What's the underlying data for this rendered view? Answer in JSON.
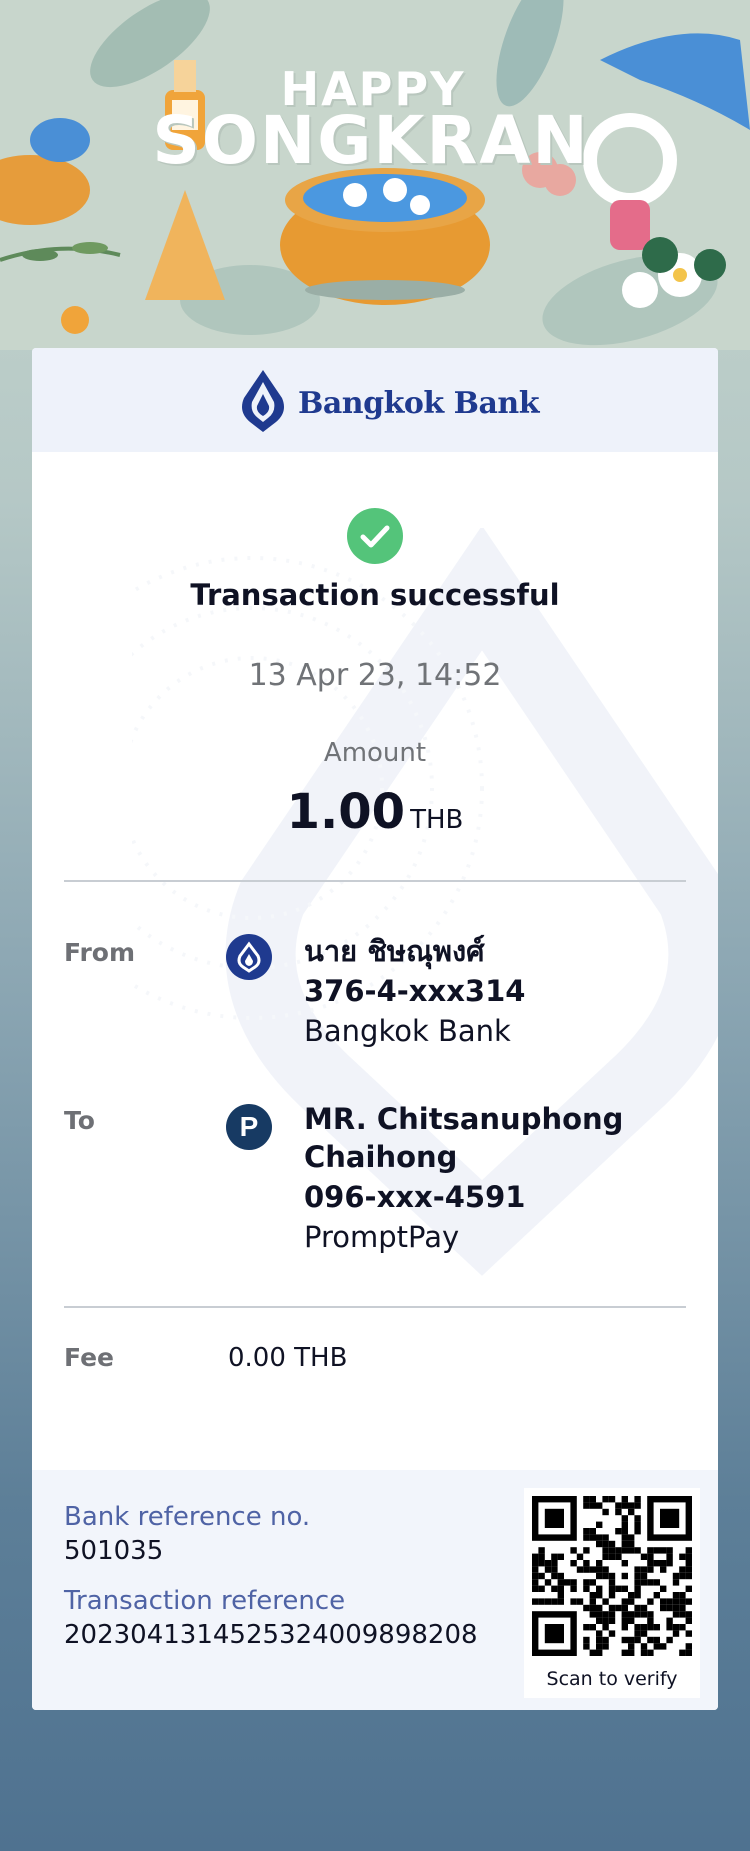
{
  "banner": {
    "line1": "HAPPY",
    "line2": "SONGKRAN"
  },
  "bank": {
    "name": "Bangkok Bank",
    "logo_icon": "bangkok-bank-lotus-icon",
    "brand_color": "#1f3a8f"
  },
  "status": {
    "icon": "check-circle-icon",
    "text": "Transaction successful",
    "color": "#54c47a"
  },
  "datetime": "13 Apr 23, 14:52",
  "amount": {
    "label": "Amount",
    "value": "1.00",
    "currency": "THB"
  },
  "from": {
    "label": "From",
    "icon": "bangkok-bank-icon",
    "name": "นาย ชิษณุพงศ์",
    "account": "376-4-xxx314",
    "bank": "Bangkok Bank"
  },
  "to": {
    "label": "To",
    "icon": "promptpay-icon",
    "icon_glyph": "P",
    "name_line1": "MR. Chitsanuphong",
    "name_line2": "Chaihong",
    "account": "096-xxx-4591",
    "bank": "PromptPay"
  },
  "fee": {
    "label": "Fee",
    "value": "0.00 THB"
  },
  "bank_reference": {
    "label": "Bank reference no.",
    "value": "501035"
  },
  "transaction_reference": {
    "label": "Transaction reference",
    "value": "2023041314525324009898208"
  },
  "qr": {
    "icon": "qr-code-icon",
    "caption": "Scan to verify"
  }
}
